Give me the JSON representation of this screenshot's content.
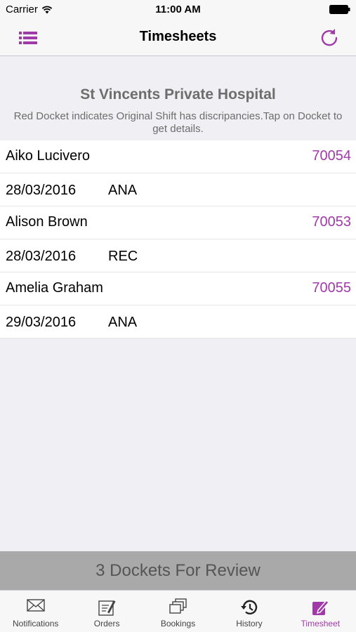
{
  "status_bar": {
    "carrier": "Carrier",
    "time": "11:00 AM"
  },
  "nav": {
    "title": "Timesheets",
    "left_icon": "menu-list-icon",
    "right_icon": "refresh-icon"
  },
  "header": {
    "hospital": "St Vincents Private Hospital",
    "note": "Red Docket indicates Original Shift has discripancies.Tap on Docket to get details."
  },
  "dockets": [
    {
      "name": "Aiko Lucivero",
      "number": "70054",
      "date": "28/03/2016",
      "code": "ANA"
    },
    {
      "name": "Alison Brown",
      "number": "70053",
      "date": "28/03/2016",
      "code": "REC"
    },
    {
      "name": "Amelia Graham",
      "number": "70055",
      "date": "29/03/2016",
      "code": "ANA"
    }
  ],
  "review_label": "3 Dockets For Review",
  "tabs": [
    {
      "label": "Notifications",
      "icon": "envelope-icon"
    },
    {
      "label": "Orders",
      "icon": "orders-icon"
    },
    {
      "label": "Bookings",
      "icon": "bookings-icon"
    },
    {
      "label": "History",
      "icon": "history-icon"
    },
    {
      "label": "Timesheet",
      "icon": "timesheet-icon",
      "active": true
    }
  ],
  "colors": {
    "accent": "#a03aa8",
    "review_bar": "#a9a9a9",
    "background": "#efeff4"
  }
}
